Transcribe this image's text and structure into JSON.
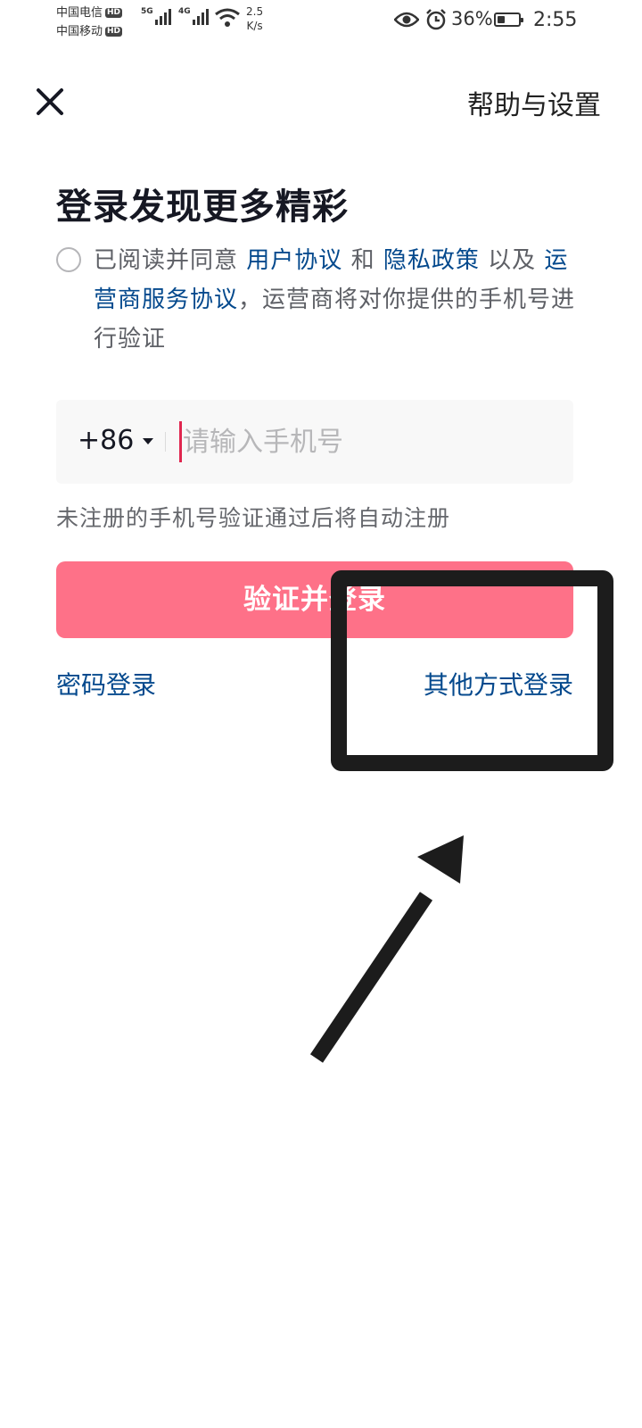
{
  "status_bar": {
    "carrier1": "中国电信",
    "carrier2": "中国移动",
    "hd_badge": "HD",
    "net1": "5G",
    "net2": "4G",
    "speed_value": "2.5",
    "speed_unit": "K/s",
    "battery": "36%",
    "battery_level": 0.36,
    "time": "2:55"
  },
  "nav": {
    "help_settings": "帮助与设置"
  },
  "title": "登录发现更多精彩",
  "agreement": {
    "text1": "已阅读并同意",
    "link_user": "用户协议",
    "and": "和",
    "link_privacy": "隐私政策",
    "also": "以及",
    "link_carrier": "运营商服务协议",
    "text2": "，运营商将对你提供的手机号进行验证"
  },
  "phone": {
    "country_code": "+86",
    "placeholder": "请输入手机号"
  },
  "hint": "未注册的手机号验证通过后将自动注册",
  "submit_label": "验证并登录",
  "password_login": "密码登录",
  "other_login": "其他方式登录",
  "annotation_color": "#1c1c1c",
  "accent_color": "#fe7188",
  "link_color": "#04498d"
}
